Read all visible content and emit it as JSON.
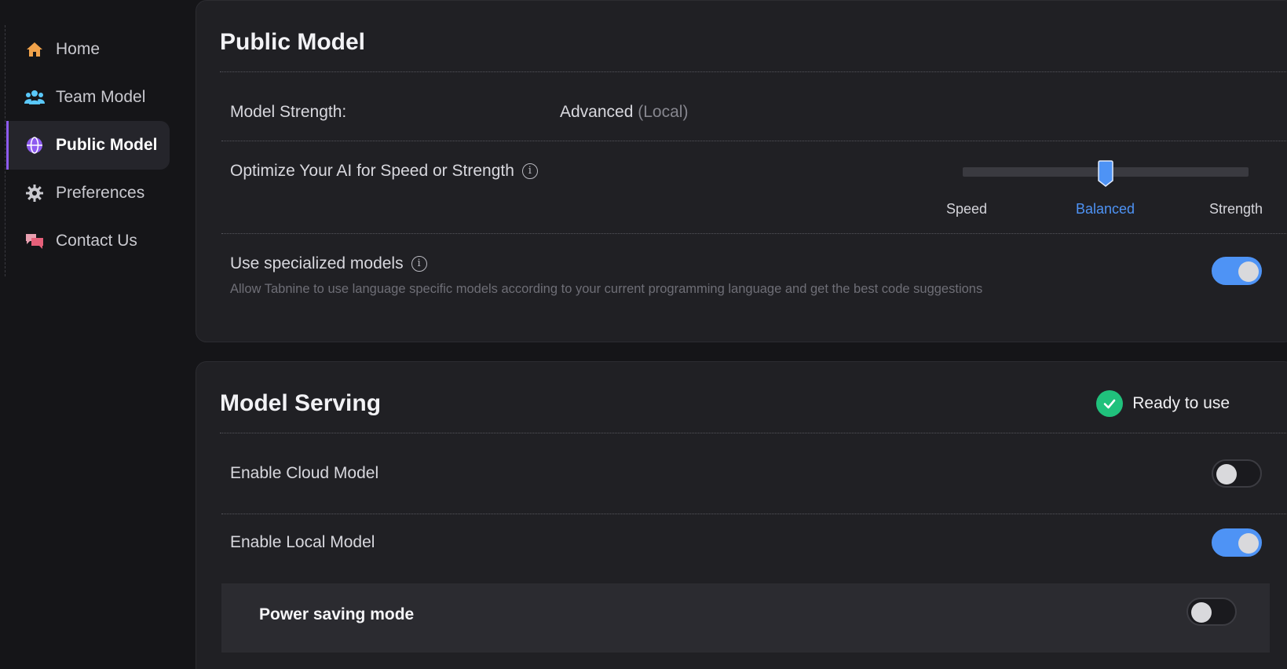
{
  "sidebar": {
    "items": [
      {
        "label": "Home",
        "icon": "home-icon",
        "color": "#f0a24a"
      },
      {
        "label": "Team Model",
        "icon": "team-icon",
        "color": "#5ac8fa"
      },
      {
        "label": "Public Model",
        "icon": "globe-icon",
        "color": "#8e5cf0",
        "active": true
      },
      {
        "label": "Preferences",
        "icon": "gear-icon",
        "color": "#c9c9cf"
      },
      {
        "label": "Contact Us",
        "icon": "chat-icon",
        "color": "#e6607a"
      }
    ]
  },
  "public_model": {
    "title": "Public Model",
    "strength_label": "Model Strength:",
    "strength_value": "Advanced",
    "strength_mode": "(Local)",
    "optimize_label": "Optimize Your AI for Speed or Strength",
    "slider": {
      "options": [
        "Speed",
        "Balanced",
        "Strength"
      ],
      "selected": "Balanced",
      "accent": "#4e93f5"
    },
    "specialized": {
      "label": "Use specialized models",
      "description": "Allow Tabnine to use language specific models according to your current programming language and get the best code suggestions",
      "enabled": true
    }
  },
  "model_serving": {
    "title": "Model Serving",
    "status": {
      "text": "Ready to use",
      "color": "#20c17c"
    },
    "cloud": {
      "label": "Enable Cloud Model",
      "enabled": false
    },
    "local": {
      "label": "Enable Local Model",
      "enabled": true
    },
    "power_saving": {
      "label": "Power saving mode",
      "enabled": false
    }
  }
}
